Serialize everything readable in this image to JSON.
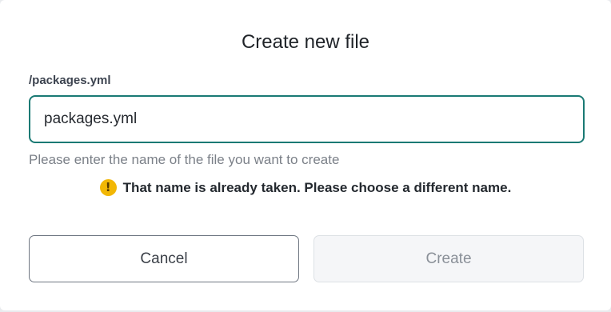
{
  "dialog": {
    "title": "Create new file",
    "path_label": "/packages.yml",
    "input": {
      "value": "packages.yml",
      "placeholder": ""
    },
    "hint": "Please enter the name of the file you want to create",
    "error": {
      "icon": "warning-icon",
      "icon_glyph": "!",
      "message": "That name is already taken. Please choose a different name."
    },
    "buttons": {
      "cancel_label": "Cancel",
      "create_label": "Create",
      "create_disabled": true
    },
    "colors": {
      "accent": "#1a7a74",
      "warning": "#f2b705"
    }
  }
}
